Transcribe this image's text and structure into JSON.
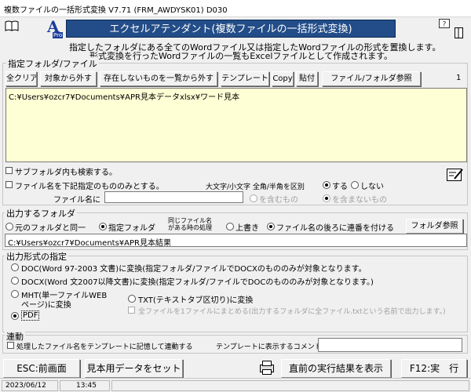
{
  "window": {
    "title": "複数ファイルの一括形式変換 V7.71 (FRM_AWDYSK01) D030"
  },
  "header": {
    "logo_text": "A",
    "logo_sub": "Pro",
    "banner": "エクセルアテンダント(複数ファイルの一括形式変換)",
    "desc_line1": "指定したフォルダにある全てのWordファイル又は指定したWordファイルの形式を置換します。",
    "desc_line2": "形式変換を行ったWordファイルの一覧もExcelファイルとして作成されます。"
  },
  "folder_section": {
    "title": "指定フォルダ/ファイル",
    "buttons": [
      "全クリア",
      "対象から外す",
      "存在しないものを一覧から外す",
      "テンプレート",
      "Copy",
      "貼付",
      "ファイル/フォルダ参照"
    ],
    "count": "1",
    "files": [
      "C:¥Users¥ozcr7¥Documents¥APR見本データxlsx¥ワード見本"
    ]
  },
  "options": {
    "subfolder_label": "サブフォルダ内も検索する。",
    "filter_label": "ファイル名を下記指定のもののみとする。",
    "case_label": "大文字/小文字 全角/半角を区別",
    "case_yes": "する",
    "case_no": "しない",
    "filename_label": "ファイル名に",
    "contains": "を含むもの",
    "not_contains": "を含まないもの"
  },
  "output_folder": {
    "title": "出力するフォルダ",
    "opt_same": "元のフォルダと同一",
    "opt_specified": "指定フォルダ",
    "same_name_label_1": "同じファイル名",
    "same_name_label_2": "がある時の処理",
    "opt_overwrite": "上書き",
    "opt_suffix": "ファイル名の後ろに連番を付ける",
    "browse_button": "フォルダ参照",
    "path": "C:¥Users¥ozcr7¥Documents¥APR見本結果"
  },
  "format": {
    "title": "出力形式の指定",
    "opt_doc": "DOC(Word 97-2003 文書)に変換(指定フォルダ/ファイルでDOCXのもののみが対象となります。",
    "opt_docx": "DOCX(Word 文2007以降文書)に変換(指定フォルダ/ファイルでDOCのもののみが対象となります。)",
    "opt_mht_1": "MHT(単一ファイルWEB",
    "opt_mht_2": "ページ)に変換",
    "opt_txt": "TXT(テキストタブ区切り)に変換",
    "merge_label": "全ファイルを1ファイルにまとめる(出力するフォルダに全ファイル.txtという名前で出力します。)",
    "opt_pdf": "PDF"
  },
  "link": {
    "title": "連動",
    "record_label": "処理したファイル名をテンプレートに記憶して連動する",
    "comment_label": "テンプレートに表示するコメント",
    "comment_value": ""
  },
  "footer": {
    "esc": "ESC:前画面",
    "sample": "見本用データをセット",
    "prev_result": "直前の実行結果を表示",
    "run": "F12:実　行"
  },
  "status": {
    "date": "2023/06/12",
    "time": "13:45"
  }
}
